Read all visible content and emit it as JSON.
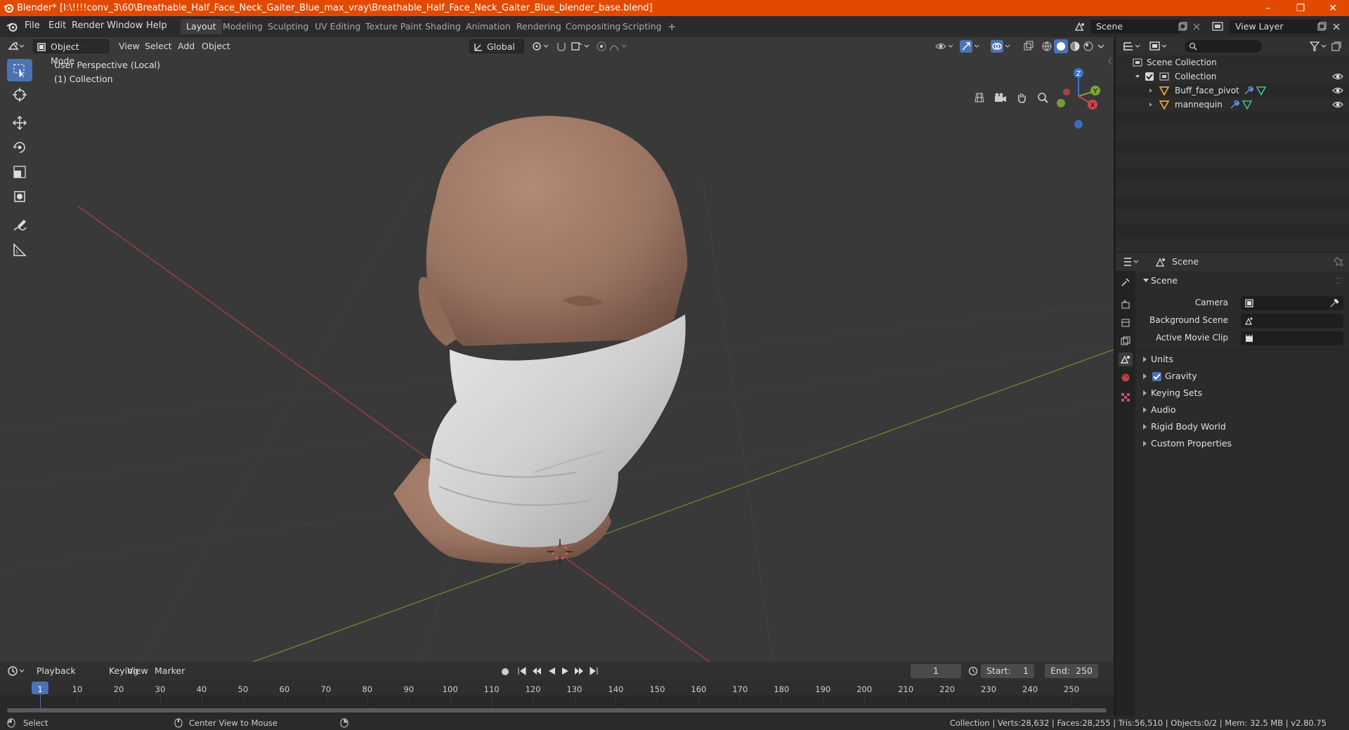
{
  "window": {
    "title": "Blender* [I:\\!!!!conv_3\\60\\Breathable_Half_Face_Neck_Gaiter_Blue_max_vray\\Breathable_Half_Face_Neck_Gaiter_Blue_blender_base.blend]",
    "controls": [
      "–",
      "❐",
      "✕"
    ]
  },
  "menubar": {
    "menus": [
      "File",
      "Edit",
      "Render",
      "Window",
      "Help"
    ],
    "workspaces": [
      "Layout",
      "Modeling",
      "Sculpting",
      "UV Editing",
      "Texture Paint",
      "Shading",
      "Animation",
      "Rendering",
      "Compositing",
      "Scripting"
    ],
    "active_workspace": "Layout",
    "add_tab": "+",
    "scene_field": "Scene",
    "view_layer_field": "View Layer"
  },
  "viewport": {
    "mode": "Object Mode",
    "menus": [
      "View",
      "Select",
      "Add",
      "Object"
    ],
    "transform_orientation": "Global",
    "overlay_line1": "User Perspective (Local)",
    "overlay_line2": "(1) Collection",
    "gizmo_axes": [
      "X",
      "Y",
      "Z"
    ],
    "tools": [
      "select-box",
      "cursor",
      "move",
      "rotate",
      "scale",
      "transform",
      "annotate",
      "measure"
    ],
    "colors": {
      "background": "#393939",
      "x_axis": "#a8403f",
      "y_axis": "#6b8a2c",
      "skin": "#9a7462",
      "gaiter": "#d9d9d9"
    }
  },
  "outliner": {
    "root": "Scene Collection",
    "items": [
      {
        "name": "Collection",
        "level": 1
      },
      {
        "name": "Buff_face_pivot",
        "level": 2
      },
      {
        "name": "mannequin",
        "level": 2
      }
    ]
  },
  "properties": {
    "context_label": "Scene",
    "panel_title": "Scene",
    "fields": [
      {
        "label": "Camera"
      },
      {
        "label": "Background Scene"
      },
      {
        "label": "Active Movie Clip"
      }
    ],
    "collapsed_panels": [
      {
        "label": "Units",
        "checkbox": false
      },
      {
        "label": "Gravity",
        "checkbox": true
      },
      {
        "label": "Keying Sets",
        "checkbox": false
      },
      {
        "label": "Audio",
        "checkbox": false
      },
      {
        "label": "Rigid Body World",
        "checkbox": false
      },
      {
        "label": "Custom Properties",
        "checkbox": false
      }
    ]
  },
  "timeline": {
    "menus": [
      "Playback",
      "Keying",
      "View",
      "Marker"
    ],
    "current_frame": "1",
    "start_label": "Start:",
    "start_value": "1",
    "end_label": "End:",
    "end_value": "250",
    "ticks": [
      "1",
      "10",
      "20",
      "30",
      "40",
      "50",
      "60",
      "70",
      "80",
      "90",
      "100",
      "110",
      "120",
      "130",
      "140",
      "150",
      "160",
      "170",
      "180",
      "190",
      "200",
      "210",
      "220",
      "230",
      "240",
      "250"
    ]
  },
  "statusbar": {
    "left_action": "Select",
    "middle_action": "Center View to Mouse",
    "stats": "Collection | Verts:28,632 | Faces:28,255 | Tris:56,510 | Objects:0/2 | Mem: 32.5 MB | v2.80.75"
  }
}
